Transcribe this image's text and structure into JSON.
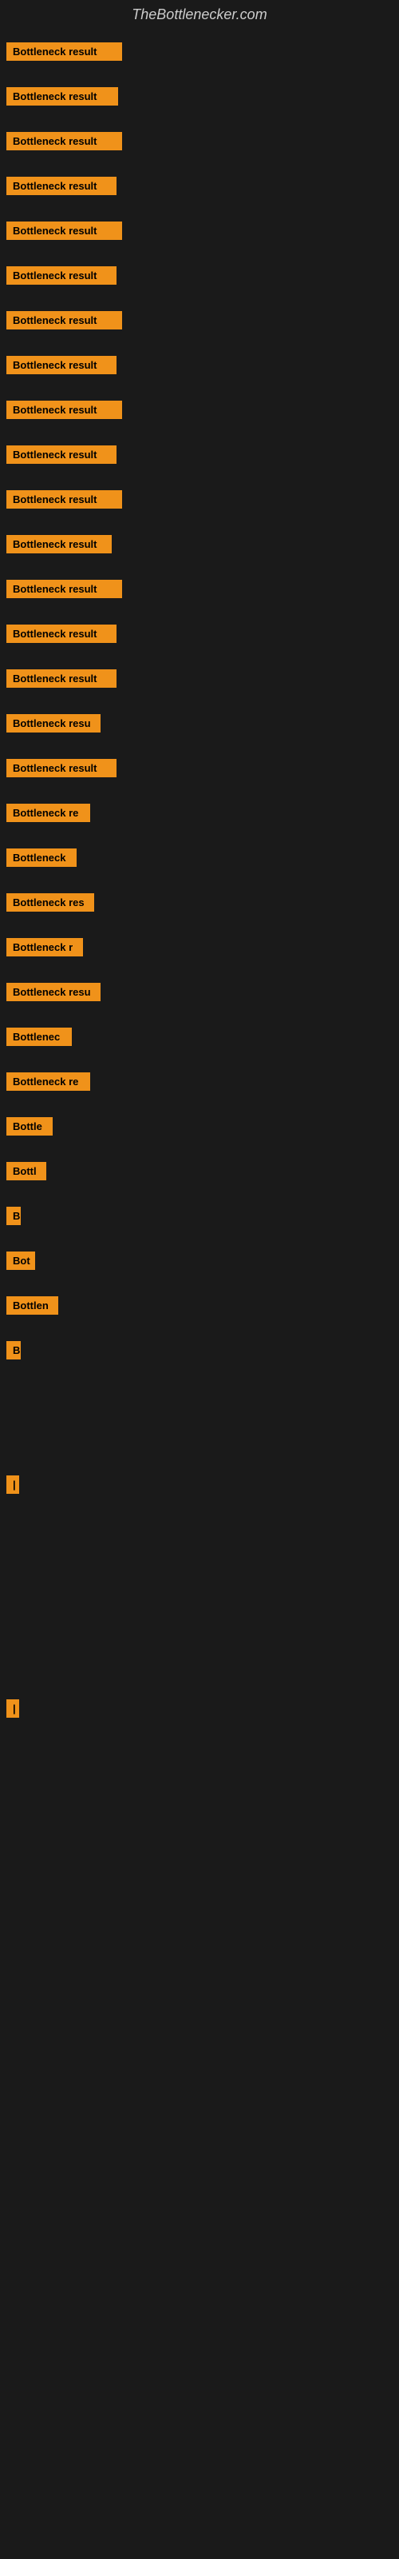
{
  "site": {
    "title": "TheBottlenecker.com"
  },
  "bars": [
    {
      "label": "Bottleneck result",
      "width": 145
    },
    {
      "label": "Bottleneck result",
      "width": 140
    },
    {
      "label": "Bottleneck result",
      "width": 145
    },
    {
      "label": "Bottleneck result",
      "width": 138
    },
    {
      "label": "Bottleneck result",
      "width": 145
    },
    {
      "label": "Bottleneck result",
      "width": 138
    },
    {
      "label": "Bottleneck result",
      "width": 145
    },
    {
      "label": "Bottleneck result",
      "width": 138
    },
    {
      "label": "Bottleneck result",
      "width": 145
    },
    {
      "label": "Bottleneck result",
      "width": 138
    },
    {
      "label": "Bottleneck result",
      "width": 145
    },
    {
      "label": "Bottleneck result",
      "width": 132
    },
    {
      "label": "Bottleneck result",
      "width": 145
    },
    {
      "label": "Bottleneck result",
      "width": 138
    },
    {
      "label": "Bottleneck result",
      "width": 138
    },
    {
      "label": "Bottleneck resu",
      "width": 118
    },
    {
      "label": "Bottleneck result",
      "width": 138
    },
    {
      "label": "Bottleneck re",
      "width": 105
    },
    {
      "label": "Bottleneck",
      "width": 88
    },
    {
      "label": "Bottleneck res",
      "width": 110
    },
    {
      "label": "Bottleneck r",
      "width": 96
    },
    {
      "label": "Bottleneck resu",
      "width": 118
    },
    {
      "label": "Bottlenec",
      "width": 82
    },
    {
      "label": "Bottleneck re",
      "width": 105
    },
    {
      "label": "Bottle",
      "width": 58
    },
    {
      "label": "Bottl",
      "width": 50
    },
    {
      "label": "B",
      "width": 18
    },
    {
      "label": "Bot",
      "width": 36
    },
    {
      "label": "Bottlen",
      "width": 65
    },
    {
      "label": "B",
      "width": 18
    },
    {
      "label": "",
      "width": 0
    },
    {
      "label": "",
      "width": 0
    },
    {
      "label": "|",
      "width": 12
    },
    {
      "label": "",
      "width": 0
    },
    {
      "label": "",
      "width": 0
    },
    {
      "label": "",
      "width": 0
    },
    {
      "label": "",
      "width": 0
    },
    {
      "label": "|",
      "width": 12
    }
  ]
}
